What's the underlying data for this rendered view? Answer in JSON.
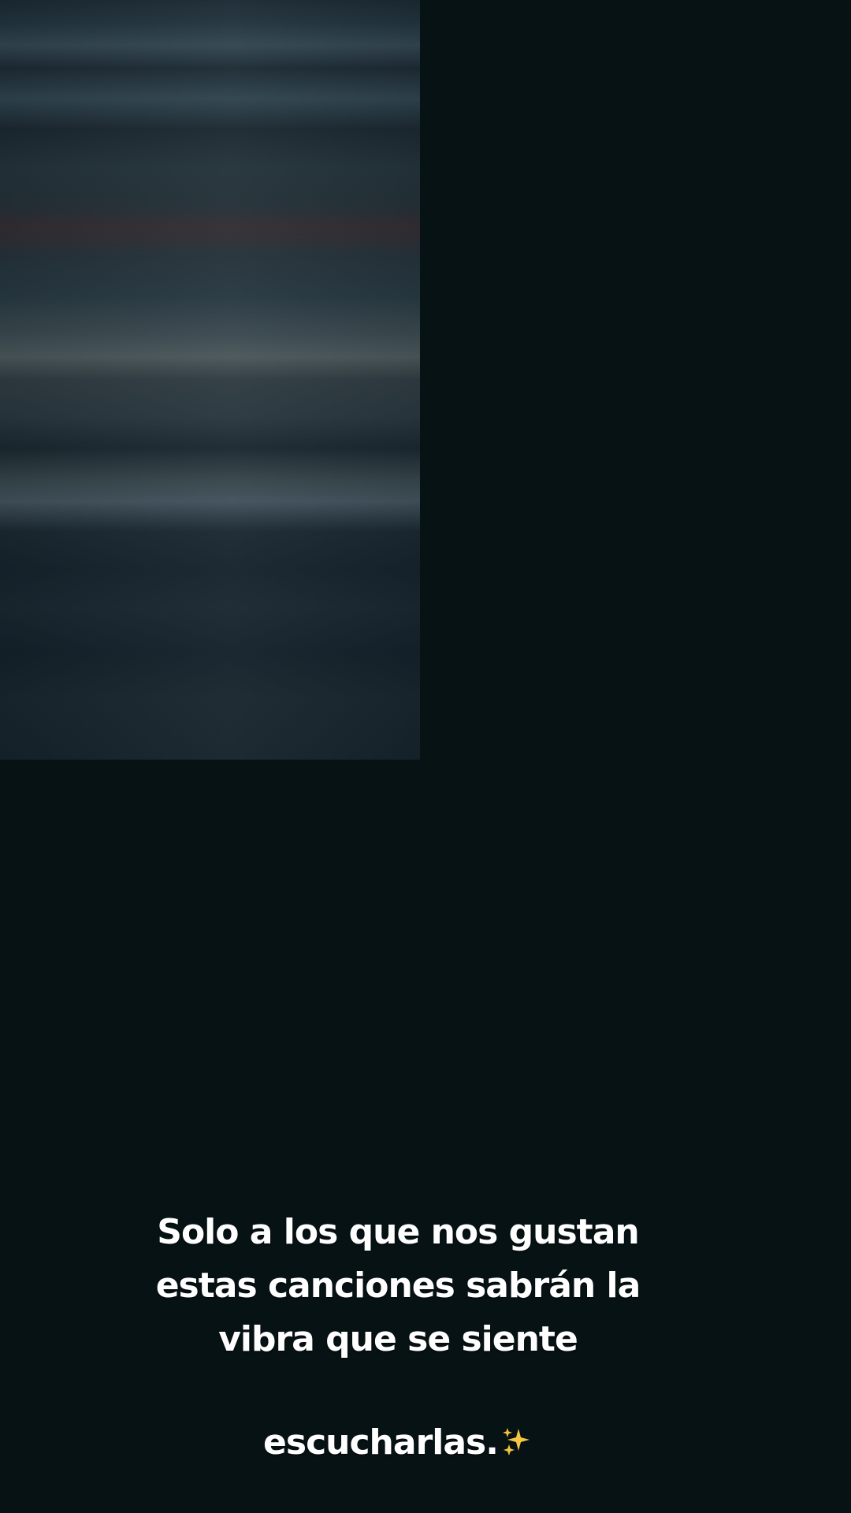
{
  "caption": {
    "text": "Solo a los que nos gustan\nestas canciones sabrán la\nvibra que se siente\nescucharlas.",
    "emoji_icon": "sparkles-icon",
    "emoji": "✨"
  },
  "colors": {
    "background": "#071214",
    "caption_text": "#ffffff",
    "sparkles": "#f5c542"
  }
}
